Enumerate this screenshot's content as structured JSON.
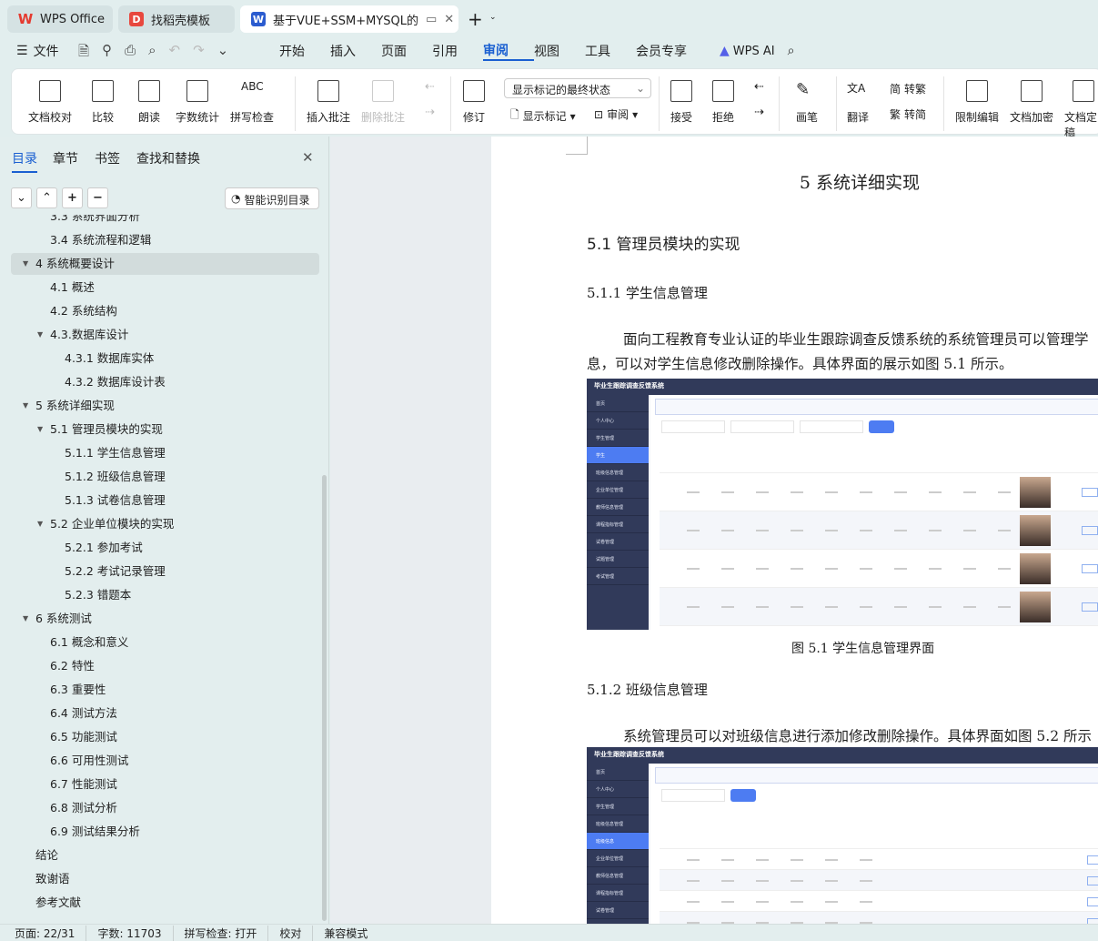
{
  "tabs": [
    {
      "label": "WPS Office",
      "icon": "wps-logo"
    },
    {
      "label": "找稻壳模板",
      "icon": "docer-logo"
    },
    {
      "label": "基于VUE+SSM+MYSQL的高",
      "icon": "word-doc-icon",
      "active": true
    }
  ],
  "menu": {
    "file": "文件",
    "items": [
      "开始",
      "插入",
      "页面",
      "引用",
      "审阅",
      "视图",
      "工具",
      "会员专享"
    ],
    "active": "审阅",
    "ai": "WPS AI"
  },
  "ribbon": {
    "proofread": "文档校对",
    "compare": "比较",
    "read_aloud": "朗读",
    "word_count": "字数统计",
    "spell_check": "拼写检查",
    "insert_comment": "插入批注",
    "delete_comment": "删除批注",
    "track": "修订",
    "markup_state": "显示标记的最终状态",
    "show_markup": "显示标记",
    "review_pane": "审阅",
    "accept": "接受",
    "reject": "拒绝",
    "pen": "画笔",
    "translate": "翻译",
    "to_traditional": "转繁",
    "to_simplified": "转简",
    "restrict_edit": "限制编辑",
    "encrypt": "文档加密",
    "finalize": "文档定稿"
  },
  "nav": {
    "tabs": [
      "目录",
      "章节",
      "书签",
      "查找和替换"
    ],
    "active": "目录",
    "smart_toc": "智能识别目录",
    "items": [
      {
        "label": "3.3 系统界面分析",
        "level": 2
      },
      {
        "label": "3.4 系统流程和逻辑",
        "level": 2
      },
      {
        "label": "4 系统概要设计",
        "level": 1,
        "expanded": true,
        "selected": true
      },
      {
        "label": "4.1 概述",
        "level": 2
      },
      {
        "label": "4.2 系统结构",
        "level": 2
      },
      {
        "label": "4.3.数据库设计",
        "level": 2,
        "expanded": true
      },
      {
        "label": "4.3.1 数据库实体",
        "level": 3
      },
      {
        "label": "4.3.2 数据库设计表",
        "level": 3
      },
      {
        "label": "5 系统详细实现",
        "level": 1,
        "expanded": true
      },
      {
        "label": "5.1  管理员模块的实现",
        "level": 2,
        "expanded": true
      },
      {
        "label": "5.1.1  学生信息管理",
        "level": 3
      },
      {
        "label": "5.1.2  班级信息管理",
        "level": 3
      },
      {
        "label": "5.1.3  试卷信息管理",
        "level": 3
      },
      {
        "label": "5.2  企业单位模块的实现",
        "level": 2,
        "expanded": true
      },
      {
        "label": "5.2.1  参加考试",
        "level": 3
      },
      {
        "label": "5.2.2  考试记录管理",
        "level": 3
      },
      {
        "label": "5.2.3  错题本",
        "level": 3
      },
      {
        "label": "6 系统测试",
        "level": 1,
        "expanded": true
      },
      {
        "label": "6.1 概念和意义",
        "level": 2
      },
      {
        "label": "6.2 特性",
        "level": 2
      },
      {
        "label": "6.3 重要性",
        "level": 2
      },
      {
        "label": "6.4 测试方法",
        "level": 2
      },
      {
        "label": "6.5  功能测试",
        "level": 2
      },
      {
        "label": "6.6 可用性测试",
        "level": 2
      },
      {
        "label": "6.7 性能测试",
        "level": 2
      },
      {
        "label": "6.8 测试分析",
        "level": 2
      },
      {
        "label": "6.9 测试结果分析",
        "level": 2
      },
      {
        "label": "结论",
        "level": 1
      },
      {
        "label": "致谢语",
        "level": 1
      },
      {
        "label": "参考文献",
        "level": 1
      }
    ]
  },
  "document": {
    "chapter": "5 系统详细实现",
    "section": "5.1  管理员模块的实现",
    "sub1": "5.1.1  学生信息管理",
    "para1_line1": "面向工程教育专业认证的毕业生跟踪调查反馈系统的系统管理员可以管理学",
    "para1_line2": "息，可以对学生信息修改删除操作。具体界面的展示如图 5.1 所示。",
    "caption1": "图 5.1  学生信息管理界面",
    "sub2": "5.1.2  班级信息管理",
    "para2": "系统管理员可以对班级信息进行添加修改删除操作。具体界面如图 5.2 所示",
    "figure_app_title": "毕业生跟踪调查反馈系统",
    "figure1_menu": [
      "首页",
      "个人中心",
      "学生管理",
      "学生",
      "班级信息管理",
      "企业单位管理",
      "教师信息管理",
      "课程指标管理",
      "试卷管理",
      "试题管理",
      "考试管理"
    ],
    "figure2_menu": [
      "首页",
      "个人中心",
      "学生管理",
      "班级信息管理",
      "班级信息",
      "企业单位管理",
      "教师信息管理",
      "课程指标管理",
      "试卷管理"
    ]
  },
  "status": {
    "page": "页面: 22/31",
    "words": "字数: 11703",
    "spell": "拼写检查: 打开",
    "proof": "校对",
    "compat": "兼容模式"
  },
  "colors": {
    "accent": "#1a5fd1",
    "app_bg": "#e2eeee",
    "figure_sidebar": "#313a5a",
    "figure_active": "#4d7cf2"
  }
}
